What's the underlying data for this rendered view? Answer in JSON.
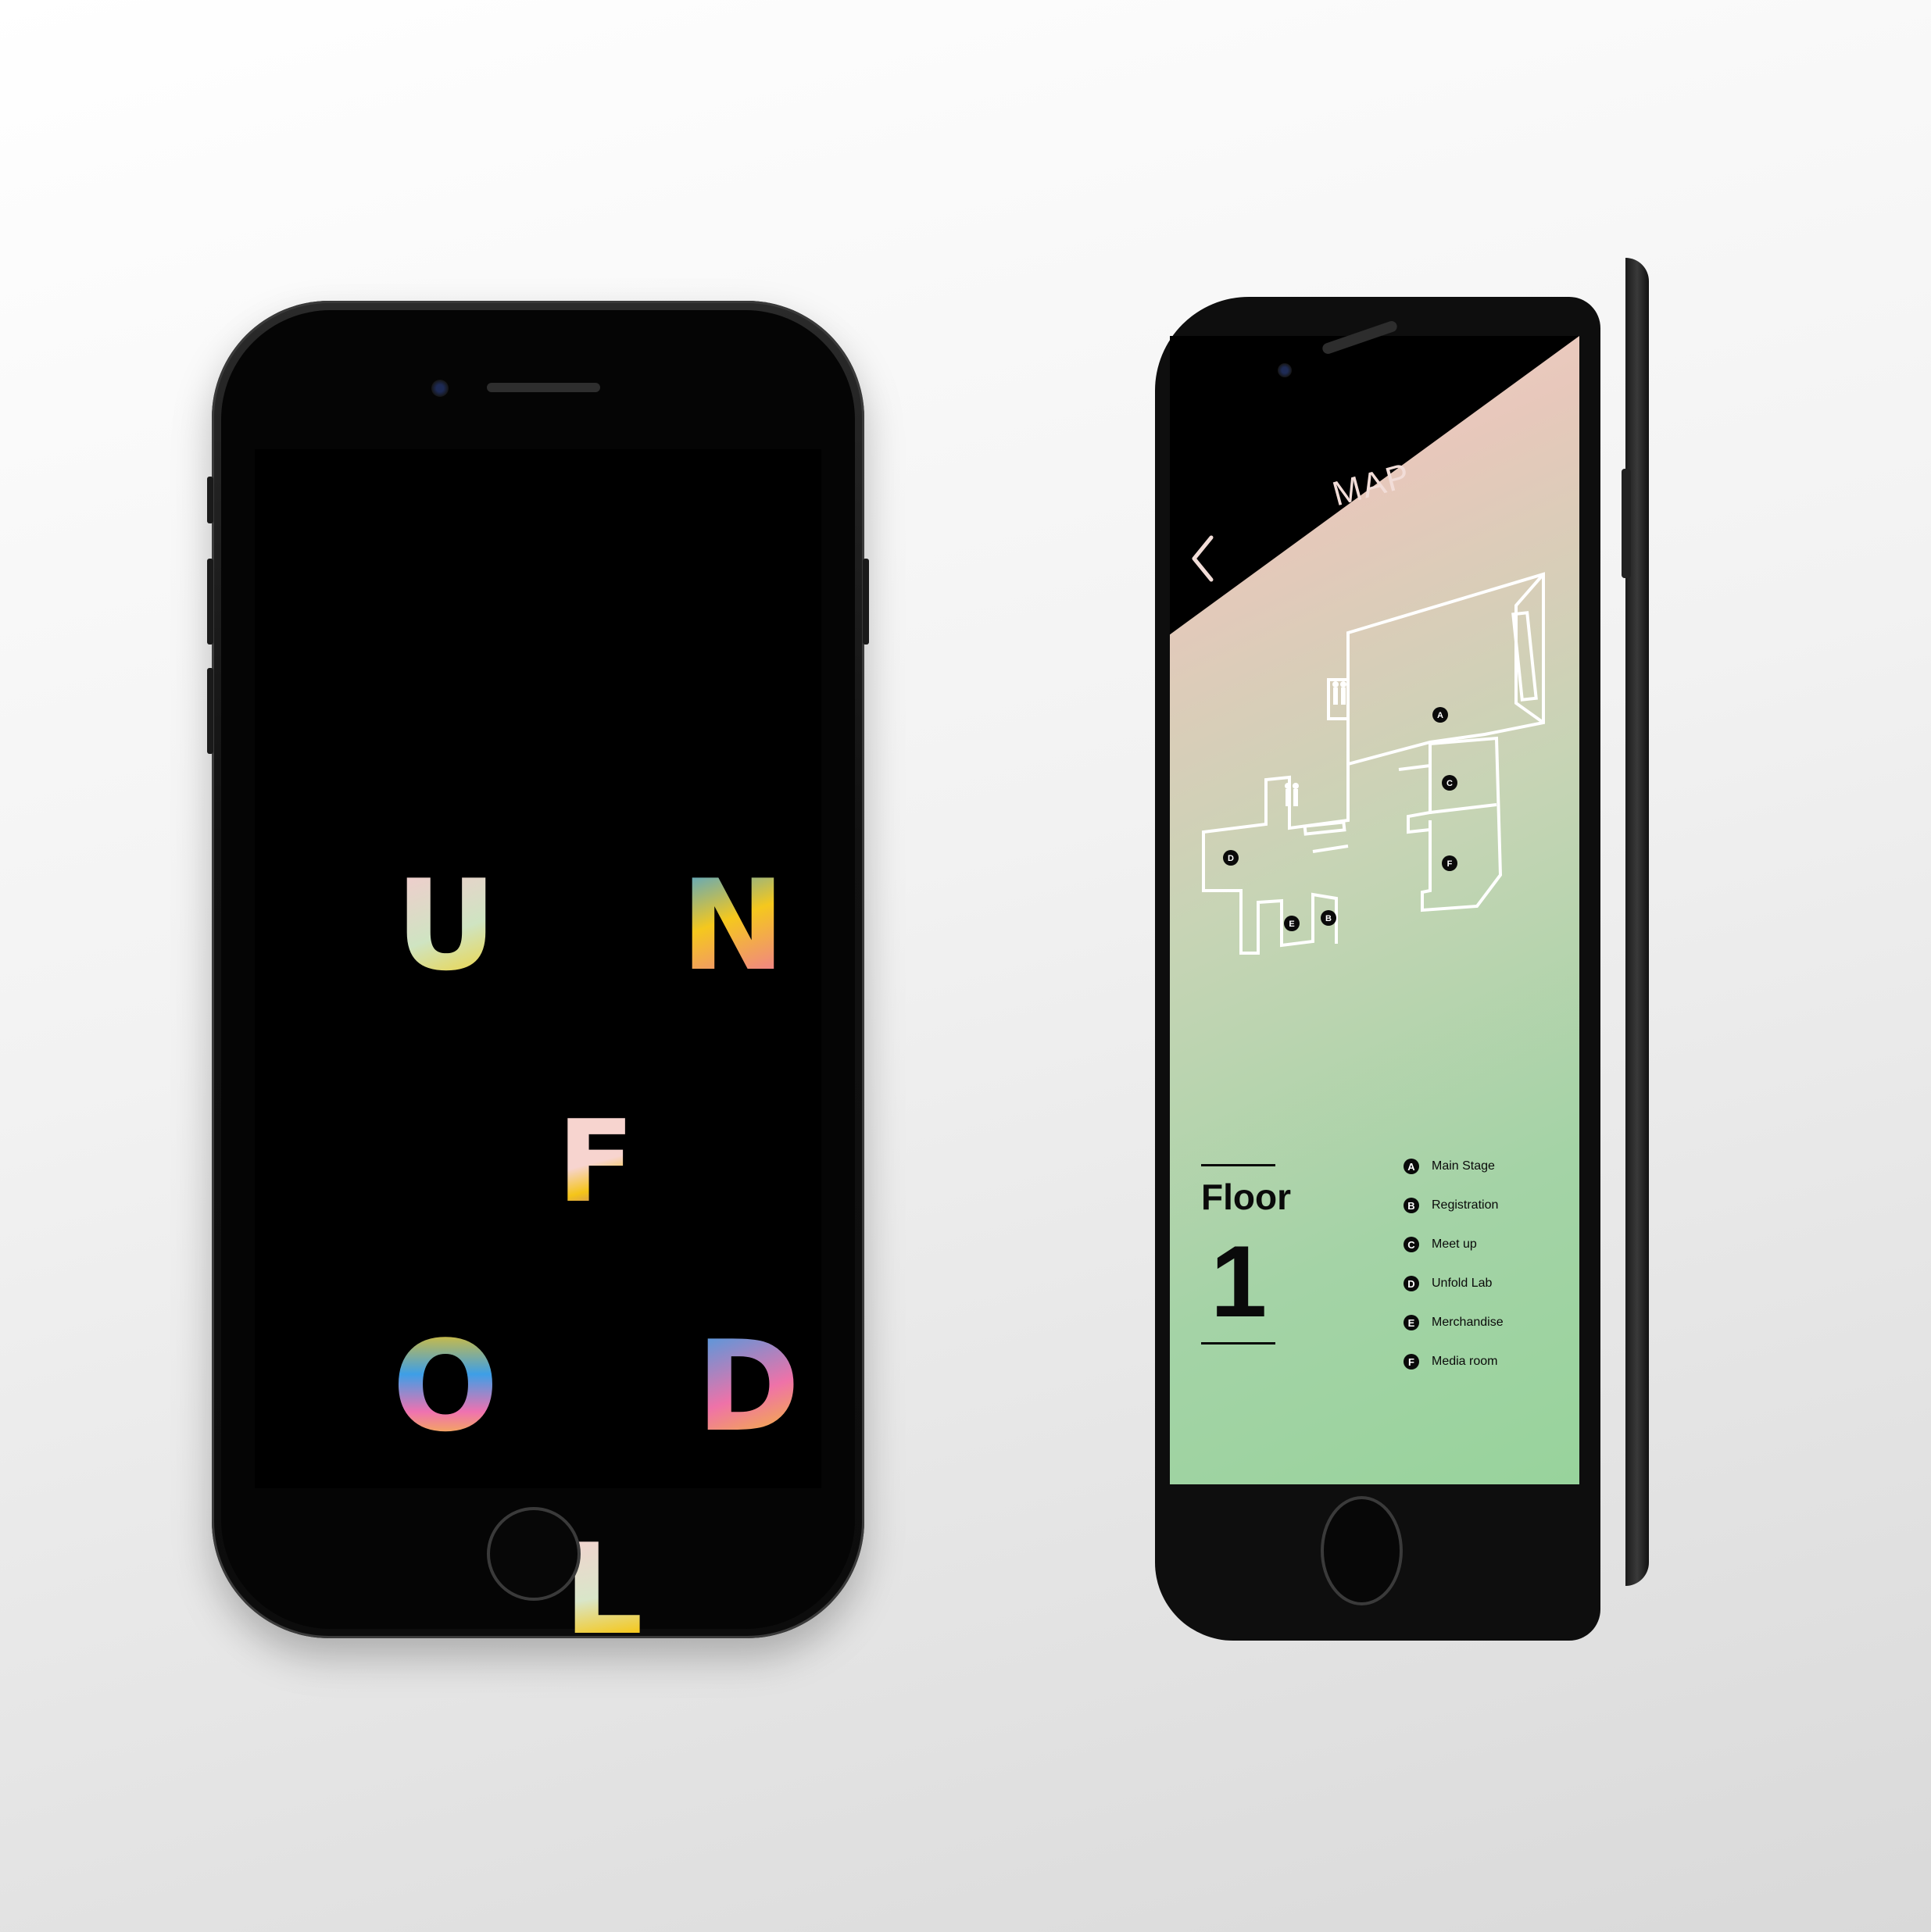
{
  "left_phone": {
    "logo_letters": [
      "U",
      "N",
      "F",
      "O",
      "D",
      "L"
    ]
  },
  "right_phone": {
    "header": {
      "title": "MAP",
      "back_icon": "chevron-left-icon"
    },
    "floor": {
      "label": "Floor",
      "number": "1"
    },
    "map_markers": [
      "A",
      "B",
      "C",
      "D",
      "E",
      "F"
    ],
    "legend": [
      {
        "badge": "A",
        "label": "Main Stage"
      },
      {
        "badge": "B",
        "label": "Registration"
      },
      {
        "badge": "C",
        "label": "Meet up"
      },
      {
        "badge": "D",
        "label": "Unfold Lab"
      },
      {
        "badge": "E",
        "label": "Merchandise"
      },
      {
        "badge": "F",
        "label": "Media room"
      }
    ]
  },
  "colors": {
    "gradient_pink": "#f5cfc8",
    "gradient_green": "#98d39c",
    "letter_blue": "#3aa0e6",
    "letter_yellow": "#f5c81d",
    "letter_pink": "#ef6fa7"
  }
}
